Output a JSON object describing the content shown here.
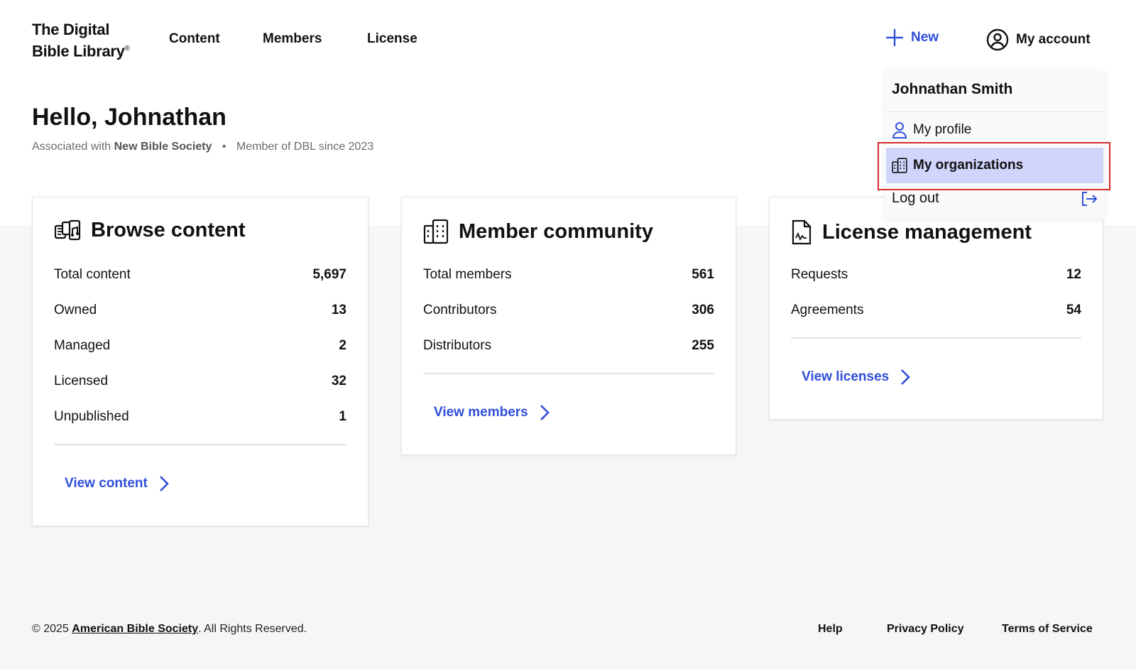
{
  "header": {
    "logo_line1": "The Digital",
    "logo_line2": "Bible Library",
    "logo_mark": "®",
    "nav": [
      "Content",
      "Members",
      "License"
    ],
    "new_label": "New",
    "account_label": "My account"
  },
  "greeting": {
    "title": "Hello, Johnathan",
    "assoc_prefix": "Associated with",
    "org": "New Bible Society",
    "separator": "•",
    "member_since": "Member of DBL since 2023"
  },
  "cards": {
    "browse": {
      "title": "Browse content",
      "rows": [
        {
          "label": "Total content",
          "value": "5,697"
        },
        {
          "label": "Owned",
          "value": "13"
        },
        {
          "label": "Managed",
          "value": "2"
        },
        {
          "label": "Licensed",
          "value": "32"
        },
        {
          "label": "Unpublished",
          "value": "1"
        }
      ],
      "link": "View content"
    },
    "members": {
      "title": "Member community",
      "rows": [
        {
          "label": "Total members",
          "value": "561"
        },
        {
          "label": "Contributors",
          "value": "306"
        },
        {
          "label": "Distributors",
          "value": "255"
        }
      ],
      "link": "View members"
    },
    "license": {
      "title": "License management",
      "rows": [
        {
          "label": "Requests",
          "value": "12"
        },
        {
          "label": "Agreements",
          "value": "54"
        }
      ],
      "link": "View licenses"
    }
  },
  "dropdown": {
    "user_name": "Johnathan Smith",
    "profile": "My profile",
    "organizations": "My organizations",
    "logout": "Log out"
  },
  "footer": {
    "copyright": "© 2025",
    "org_link": "American Bible Society",
    "rights": ". All Rights Reserved.",
    "help": "Help",
    "privacy": "Privacy Policy",
    "terms": "Terms of Service"
  },
  "colors": {
    "accent": "#2f4fd9",
    "selected_bg": "#d0d5fb",
    "highlight_border": "#d62b2b"
  }
}
